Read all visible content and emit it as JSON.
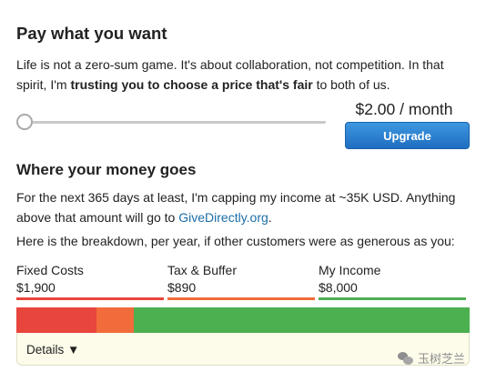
{
  "heading": "Pay what you want",
  "intro": {
    "part1": "Life is not a zero-sum game. It's about collaboration, not competition. In that spirit, I'm ",
    "bold": "trusting you to choose a price that's fair",
    "part2": " to both of us."
  },
  "slider": {
    "value_fraction": 0.0
  },
  "price_label": "$2.00 / month",
  "upgrade_button": "Upgrade",
  "money_heading": "Where your money goes",
  "cap_text": {
    "part1": "For the next 365 days at least, I'm capping my income at ~35K USD. Anything above that amount will go to ",
    "link": "GiveDirectly.org",
    "part2": "."
  },
  "breakdown_intro": "Here is the breakdown, per year, if other customers were as generous as you:",
  "breakdown": [
    {
      "label": "Fixed Costs",
      "amount": "$1,900",
      "value": 1900,
      "color": "#e8453c"
    },
    {
      "label": "Tax & Buffer",
      "amount": "$890",
      "value": 890,
      "color": "#f26b3a"
    },
    {
      "label": "My Income",
      "amount": "$8,000",
      "value": 8000,
      "color": "#4caf50"
    }
  ],
  "details_label": "Details ▼",
  "watermark": "玉树芝兰"
}
